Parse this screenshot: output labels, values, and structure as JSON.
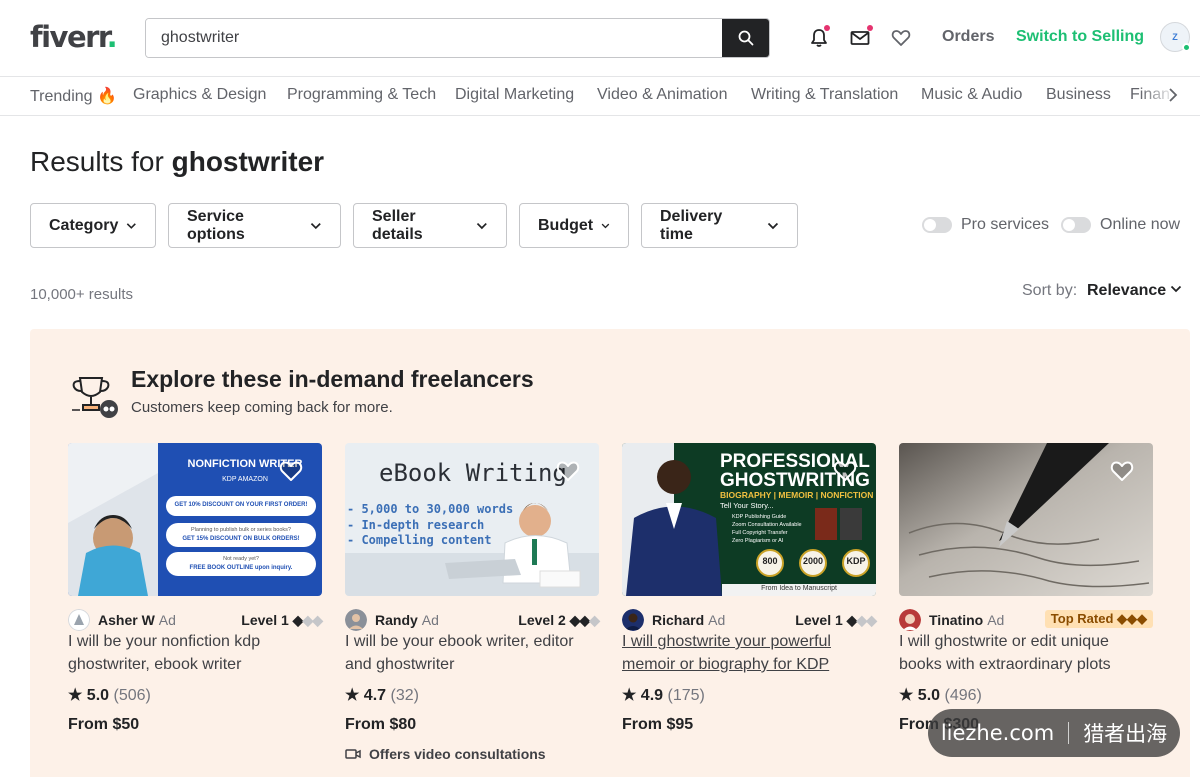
{
  "header": {
    "logo_text": "fiverr",
    "logo_dot": ".",
    "search_value": "ghostwriter",
    "orders_label": "Orders",
    "switch_label": "Switch to Selling",
    "icons": [
      "bell-icon",
      "mail-icon",
      "heart-icon",
      "search-icon"
    ],
    "avatar_text": "Z"
  },
  "categories": [
    "Trending 🔥",
    "Graphics & Design",
    "Programming & Tech",
    "Digital Marketing",
    "Video & Animation",
    "Writing & Translation",
    "Music & Audio",
    "Business",
    "Finan"
  ],
  "results": {
    "prefix": "Results for ",
    "query": "ghostwriter",
    "count": "10,000+ results"
  },
  "filters": [
    "Category",
    "Service options",
    "Seller details",
    "Budget",
    "Delivery time"
  ],
  "toggles": [
    "Pro services",
    "Online now"
  ],
  "sort": {
    "label": "Sort by:",
    "value": "Relevance"
  },
  "promo": {
    "title": "Explore these in-demand freelancers",
    "subtitle": "Customers keep coming back for more."
  },
  "cards": [
    {
      "seller": "Asher W",
      "ad": "Ad",
      "level": "Level 1",
      "title": "I will be your nonfiction kdp ghostwriter, ebook writer",
      "rating": "5.0",
      "reviews": "(506)",
      "price": "From $50",
      "thumb": {
        "headline": "NONFICTION WRITER",
        "sub": "KDP AMAZON",
        "lines": [
          "GET 10% DISCOUNT ON YOUR FIRST ORDER!",
          "Planning to publish bulk or series books?",
          "GET 15% DISCOUNT ON BULK ORDERS!",
          "Not ready yet?",
          "FREE BOOK OUTLINE upon inquiry."
        ]
      }
    },
    {
      "seller": "Randy",
      "ad": "Ad",
      "level": "Level 2",
      "title": "I will be your ebook writer, editor and ghostwriter",
      "rating": "4.7",
      "reviews": "(32)",
      "price": "From $80",
      "video": "Offers video consultations",
      "thumb": {
        "headline": "eBook Writing",
        "lines": [
          "- 5,000 to 30,000 words",
          "- In-depth research",
          "- Compelling content"
        ]
      }
    },
    {
      "seller": "Richard",
      "ad": "Ad",
      "level": "Level 1",
      "title": "I will ghostwrite your powerful memoir or biography for KDP",
      "rating": "4.9",
      "reviews": "(175)",
      "price": "From $95",
      "thumb": {
        "headline": "PROFESSIONAL GHOSTWRITING",
        "sub": "BIOGRAPHY | MEMOIR | NONFICTION",
        "tell": "Tell Your Story...",
        "lines": [
          "KDP Publishing Guide",
          "Zoom Consultation Available",
          "Full Copyright Transfer",
          "Zero Plagiarism or AI"
        ],
        "badges": [
          "800",
          "2000",
          "KDP"
        ],
        "footer": "From Idea to Manuscript"
      }
    },
    {
      "seller": "Tinatino",
      "ad": "Ad",
      "level": "Top Rated",
      "title": "I will ghostwrite or edit unique books with extraordinary plots",
      "rating": "5.0",
      "reviews": "(496)",
      "price": "From $300"
    }
  ],
  "watermark": {
    "left": "liezhe.com",
    "right": "猎者出海"
  },
  "colors": {
    "brand_green": "#1dbf73",
    "promo_bg": "#fdf1e8",
    "dark": "#222325",
    "badge_red": "#e5336f"
  }
}
